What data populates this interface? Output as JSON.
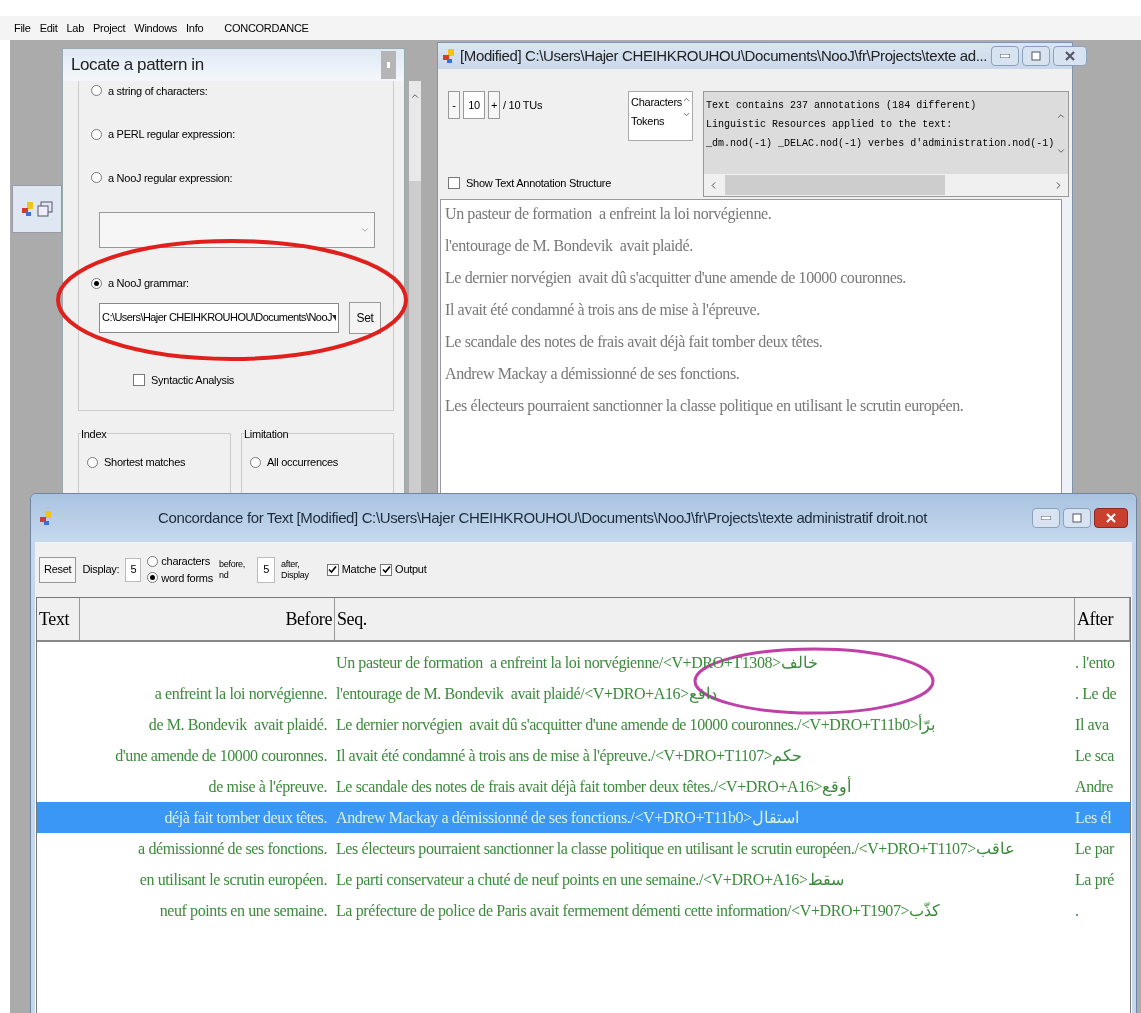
{
  "menu_bar": {
    "items": [
      "File",
      "Edit",
      "Lab",
      "Project",
      "Windows",
      "Info"
    ],
    "context": "CONCORDANCE"
  },
  "locate_panel": {
    "title": "Locate a pattern in",
    "options": [
      {
        "kind": "plain",
        "label": "a string of characters:",
        "selected": false
      },
      {
        "kind": "plain",
        "label": "a PERL regular expression:",
        "selected": false
      },
      {
        "kind": "combo",
        "label": "a NooJ regular expression:",
        "selected": false
      },
      {
        "kind": "grammar",
        "label": "a NooJ grammar:",
        "selected": true,
        "path": "C:\\Users\\Hajer CHEIHKROUHOU\\Documents\\NooJ",
        "button": "Set",
        "checkbox": {
          "label": "Syntactic Analysis",
          "checked": false
        }
      }
    ],
    "groups": [
      {
        "title": "Index",
        "option": {
          "label": "Shortest matches",
          "selected": false
        }
      },
      {
        "title": "Limitation",
        "option": {
          "label": "All occurrences",
          "selected": false
        }
      }
    ]
  },
  "text_window": {
    "title": "[Modified] C:\\Users\\Hajer CHEIHKROUHOU\\Documents\\NooJ\\fr\\Projects\\texte ad...",
    "minus": "-",
    "tu_value": "10",
    "plus": "+",
    "tu_total": "/ 10 TUs",
    "unit_list": [
      "Characters",
      "Tokens"
    ],
    "info_lines": [
      "Text contains 237 annotations (184 different)",
      "Linguistic Resources applied to the text:",
      "_dm.nod(-1) _DELAC.nod(-1) verbes d'administration.nod(-1)"
    ],
    "show_structure": {
      "label": "Show Text Annotation Structure",
      "checked": false
    },
    "lines": [
      "Un pasteur de formation  a enfreint la loi norvégienne.",
      "l'entourage de M. Bondevik  avait plaidé.",
      "Le dernier norvégien  avait dû s'acquitter d'une amende de 10000 couronnes.",
      "Il avait été condamné à trois ans de mise à l'épreuve.",
      "Le scandale des notes de frais avait déjà fait tomber deux têtes.",
      "Andrew Mackay a démissionné de ses fonctions.",
      "Les électeurs pourraient sanctionner la classe politique en utilisant le scrutin européen."
    ]
  },
  "concordance_window": {
    "title": "Concordance for Text [Modified] C:\\Users\\Hajer CHEIHKROUHOU\\Documents\\NooJ\\fr\\Projects\\texte administratif droit.not",
    "toolbar": {
      "reset": "Reset",
      "display_label": "Display:",
      "before_value": "5",
      "units": [
        {
          "label": "characters",
          "selected": false
        },
        {
          "label": "word forms",
          "selected": true
        }
      ],
      "before_note": [
        "before,",
        "nd"
      ],
      "after_value": "5",
      "after_note": [
        "after,",
        "Display"
      ],
      "checks": [
        {
          "label": "Matche",
          "checked": true
        },
        {
          "label": "Output",
          "checked": true
        }
      ]
    },
    "columns": [
      "Text",
      "Before",
      "Seq.",
      "After"
    ],
    "rows": [
      {
        "before": "",
        "seq": "Un pasteur de formation  a enfreint la loi norvégienne/<V+DRO+T1308>خالف",
        "after": ". l'ento",
        "selected": false
      },
      {
        "before": "a enfreint la loi norvégienne.",
        "seq": "l'entourage de M. Bondevik  avait plaidé/<V+DRO+A16>دافع",
        "after": ". Le de",
        "selected": false
      },
      {
        "before": "de M. Bondevik  avait plaidé.",
        "seq": "Le dernier norvégien  avait dû s'acquitter d'une amende de 10000 couronnes./<V+DRO+T11b0>برّأ",
        "after": "Il ava",
        "selected": false
      },
      {
        "before": "d'une amende de 10000 couronnes.",
        "seq": "Il avait été condamné à trois ans de mise à l'épreuve./<V+DRO+T1107>حكم",
        "after": "Le sca",
        "selected": false
      },
      {
        "before": "de mise à l'épreuve.",
        "seq": "Le scandale des notes de frais avait déjà fait tomber deux têtes./<V+DRO+A16>أوقع",
        "after": "Andre",
        "selected": false
      },
      {
        "before": "déjà fait tomber deux têtes.",
        "seq": "Andrew Mackay a démissionné de ses fonctions./<V+DRO+T11b0>استقال",
        "after": "Les él",
        "selected": true
      },
      {
        "before": "a démissionné de ses fonctions.",
        "seq": "Les électeurs pourraient sanctionner la classe politique en utilisant le scrutin européen./<V+DRO+T1107>عاقب",
        "after": "Le par",
        "selected": false
      },
      {
        "before": "en utilisant le scrutin européen.",
        "seq": "Le parti conservateur a chuté de neuf points en une semaine./<V+DRO+A16>سقط",
        "after": "La pré",
        "selected": false
      },
      {
        "before": "neuf points en une semaine.",
        "seq": "La préfecture de police de Paris avait fermement démenti cette information/<V+DRO+T1907>كذّب",
        "after": ".",
        "selected": false
      }
    ]
  }
}
